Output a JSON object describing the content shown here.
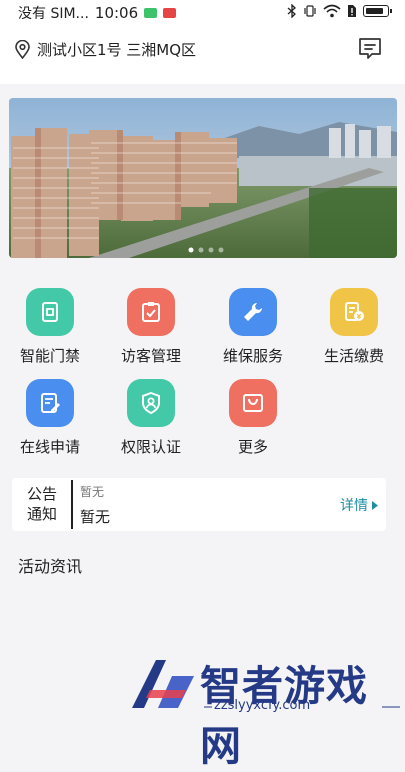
{
  "status_bar": {
    "carrier": "没有 SIM...",
    "time": "10:06",
    "battery_level": 0.9
  },
  "header": {
    "location_text": "测试小区1号 三湘MQ区",
    "location_icon": "map-pin-icon",
    "message_icon": "message-icon"
  },
  "banner": {
    "slide_count": 4,
    "active_index": 0
  },
  "quick_actions": [
    {
      "label": "智能门禁",
      "icon": "door-access-icon",
      "color": "#43c9a8"
    },
    {
      "label": "访客管理",
      "icon": "visitor-icon",
      "color": "#ef6f60"
    },
    {
      "label": "维保服务",
      "icon": "wrench-icon",
      "color": "#4a8ff0"
    },
    {
      "label": "生活缴费",
      "icon": "payment-icon",
      "color": "#efc447"
    },
    {
      "label": "在线申请",
      "icon": "edit-icon",
      "color": "#4a8ff0"
    },
    {
      "label": "权限认证",
      "icon": "shield-user-icon",
      "color": "#43c9a8"
    },
    {
      "label": "更多",
      "icon": "bag-icon",
      "color": "#ef6f60"
    }
  ],
  "notice": {
    "tag_line1": "公告",
    "tag_line2": "通知",
    "subtitle": "暂无",
    "content": "暂无",
    "detail_label": "详情"
  },
  "news": {
    "title": "活动资讯"
  },
  "watermark": {
    "brand": "智者游戏网",
    "url": "zzslyyxcfy.com"
  }
}
